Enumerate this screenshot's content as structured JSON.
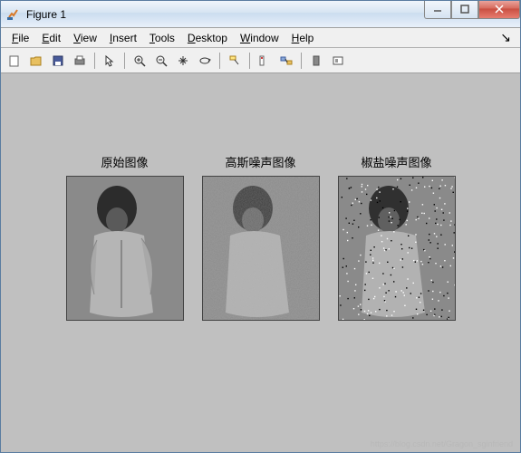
{
  "window": {
    "title": "Figure 1",
    "app_icon": "matlab-icon"
  },
  "window_controls": {
    "minimize": "minimize",
    "maximize": "maximize",
    "close": "close"
  },
  "menu": {
    "file": "File",
    "edit": "Edit",
    "view": "View",
    "insert": "Insert",
    "tools": "Tools",
    "desktop": "Desktop",
    "window": "Window",
    "help": "Help",
    "dock": "↘"
  },
  "toolbar": {
    "new": "new-figure",
    "open": "open",
    "save": "save",
    "print": "print",
    "pointer": "edit-plot",
    "zoom_in": "zoom-in",
    "zoom_out": "zoom-out",
    "pan": "pan",
    "rotate": "rotate-3d",
    "datacursor": "data-cursor",
    "brush": "brush",
    "link": "link",
    "colorbar": "insert-colorbar",
    "legend": "insert-legend"
  },
  "subplots": {
    "img1": {
      "caption": "原始图像",
      "desc": "original-image"
    },
    "img2": {
      "caption": "高斯噪声图像",
      "desc": "gaussian-noise-image"
    },
    "img3": {
      "caption": "椒盐噪声图像",
      "desc": "salt-pepper-noise-image"
    }
  },
  "watermark": "https://blog.csdn.net/Gragon_sginfriend"
}
